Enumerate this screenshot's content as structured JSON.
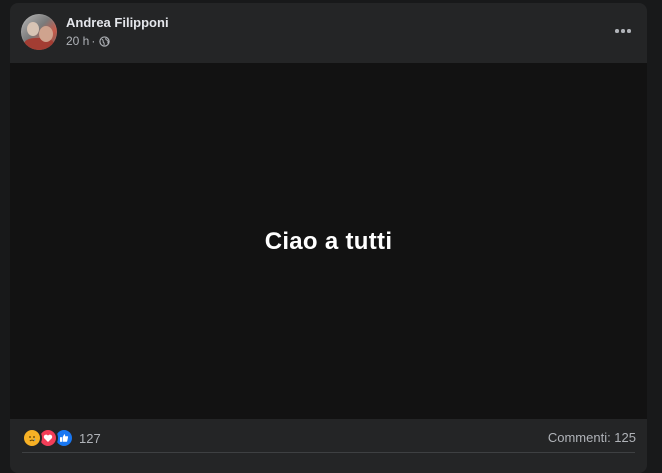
{
  "post": {
    "author": "Andrea Filipponi",
    "time": "20 h",
    "separator": "·",
    "privacy_icon": "globe-icon",
    "text": "Ciao a tutti"
  },
  "stats": {
    "reaction_icons": [
      "sad-reaction-icon",
      "love-reaction-icon",
      "like-reaction-icon"
    ],
    "reaction_count": "127",
    "comments": "Commenti: 125"
  },
  "colors": {
    "page_bg": "#18191a",
    "card_bg": "#242526",
    "post_bg": "#121212",
    "text_primary": "#e4e6eb",
    "text_secondary": "#b0b3b8",
    "like_blue": "#1877f2",
    "love_red": "#f33e58",
    "sad_yellow": "#f7b125"
  }
}
